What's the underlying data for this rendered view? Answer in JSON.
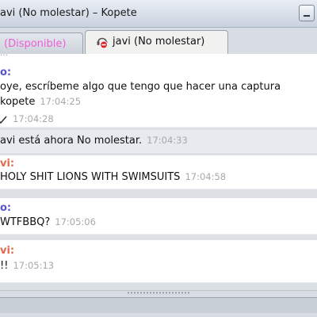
{
  "window": {
    "title": "avi (No molestar) – Kopete"
  },
  "tabs": [
    {
      "label": "(Disponible)",
      "state": "inactive",
      "color": "#ee5dd7"
    },
    {
      "label": "javi (No molestar)",
      "state": "active",
      "icon": "do-not-disturb-icon"
    }
  ],
  "chat": {
    "nick_colors": {
      "me": "#5a53cf",
      "them": "#e06a4b"
    },
    "m1": {
      "cut_text": "…",
      "nick": "o:",
      "text": "oye, escríbeme algo que tengo que hacer una captura",
      "text2": "kopete",
      "ts2": "17:04:25",
      "ts3": "17:04:28"
    },
    "sys1": {
      "text": "avi está ahora No molestar.",
      "ts": "17:04:33"
    },
    "m2": {
      "nick": "vi:",
      "text": "HOLY SHIT LIONS WITH SWIMSUITS",
      "ts": "17:04:58"
    },
    "m3": {
      "nick": "o:",
      "text": "WTFBBQ?",
      "ts": "17:05:06"
    },
    "m4": {
      "nick": "vi:",
      "text": "!!",
      "ts": "17:05:13"
    }
  }
}
